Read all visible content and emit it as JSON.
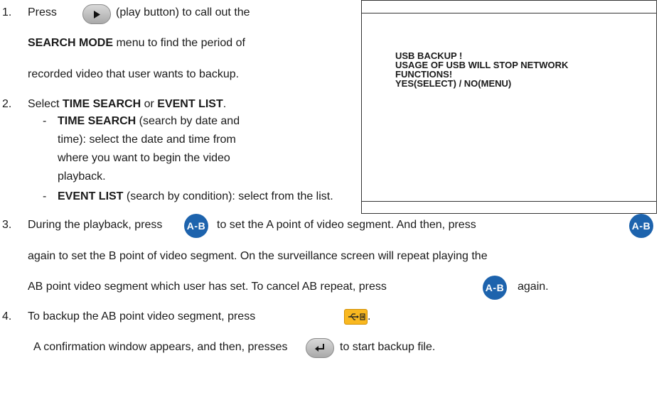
{
  "steps": [
    {
      "num": "1.",
      "pre": "Press",
      "post": "(play button) to call out the",
      "line2_bold": "SEARCH MODE",
      "line2_rest": " menu to find the period of",
      "line3": "recorded video that user wants to backup."
    },
    {
      "num": "2.",
      "pre": "Select ",
      "bold1": "TIME SEARCH",
      "mid": " or ",
      "bold2": "EVENT LIST",
      "end": ".",
      "sub1_dash": "-",
      "sub1_bold": "TIME SEARCH",
      "sub1_lines": [
        " (search by date and",
        "time): select the date and time from",
        "where you want to begin the video",
        "playback."
      ],
      "sub2_dash": "-",
      "sub2_bold": "EVENT LIST",
      "sub2_rest": " (search by condition): select from the list."
    },
    {
      "num": "3.",
      "line1_pre": "During the playback, press",
      "line1_mid": "to set the A point of video segment. And then, press",
      "line2": "again to set the B point of video segment. On the surveillance screen will repeat playing the",
      "line3_pre": "AB point video segment which user has set. To cancel AB repeat, press",
      "line3_post": "again."
    },
    {
      "num": "4.",
      "line1_pre": "To backup the AB point video segment, press",
      "line1_post": ".",
      "line2_pre": "A confirmation window appears, and then, presses",
      "line2_post": "to start backup file."
    }
  ],
  "ab_badge_label": "A-B",
  "icons": {
    "play": "play-icon",
    "enter": "enter-icon",
    "usb": "usb-icon"
  },
  "dialog": {
    "message": "USB BACKUP !\nUSAGE OF USB WILL STOP NETWORK\nFUNCTIONS!\nYES(SELECT) / NO(MENU)"
  },
  "colors": {
    "ab_badge": "#1d63ad",
    "usb_icon": "#f9b820"
  }
}
